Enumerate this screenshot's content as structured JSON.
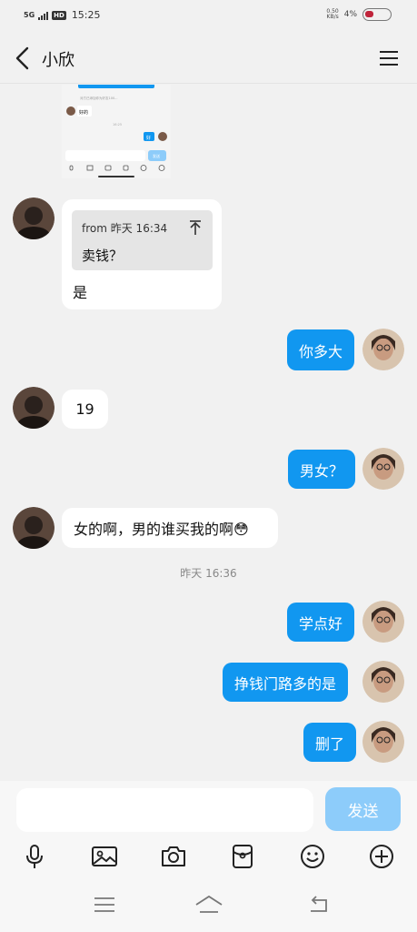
{
  "status_bar": {
    "network": "5G",
    "hd": "HD",
    "time": "15:25",
    "speed_value": "0.50",
    "speed_unit": "KB/s",
    "battery_percent": "4%"
  },
  "header": {
    "title": "小欣",
    "back_icon": "back-arrow-icon",
    "menu_icon": "hamburger-menu-icon"
  },
  "messages": {
    "quote": {
      "from": "from 昨天 16:34",
      "text": "卖钱？",
      "reply": "是"
    },
    "out_1": "你多大",
    "in_1": "19",
    "out_2": "男女？",
    "in_2": "女的啊，男的谁买我的啊😳",
    "timestamp": "昨天 16:36",
    "out_3": "学点好",
    "out_4": "挣钱门路多的是",
    "out_5": "删了"
  },
  "thumbnail": {
    "caption": "好的",
    "small_text": "对方已添加你为好友100...",
    "time": "16:25",
    "bubble": "好",
    "send": "发送"
  },
  "input": {
    "placeholder": "",
    "send_label": "发送"
  },
  "toolbar": [
    "microphone-icon",
    "image-icon",
    "camera-icon",
    "red-packet-icon",
    "emoji-icon",
    "plus-icon"
  ],
  "navbar": [
    "menu-nav-icon",
    "home-nav-icon",
    "back-nav-icon"
  ],
  "colors": {
    "accent": "#1197f0",
    "send_disabled": "#8dccfa",
    "background": "#f1f1f1"
  }
}
